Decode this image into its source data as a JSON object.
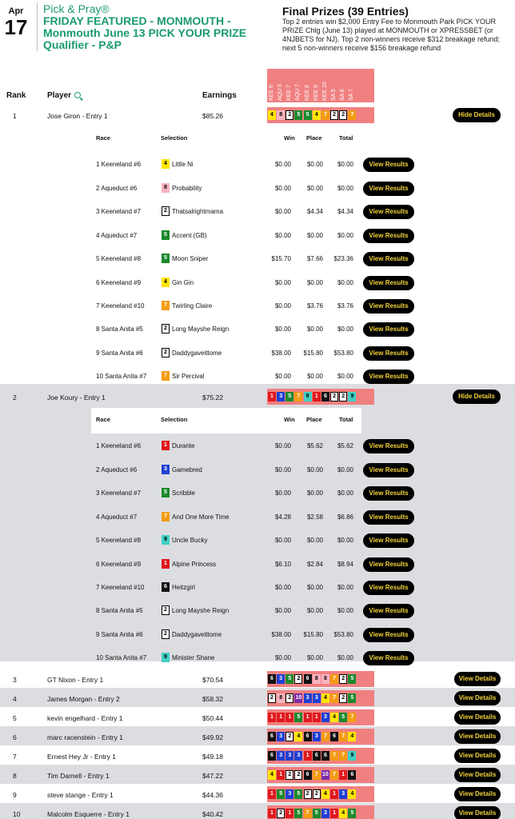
{
  "header": {
    "month": "Apr",
    "day": "17",
    "contest_type": "Pick & Pray®",
    "contest_title": "FRIDAY FEATURED - MONMOUTH - Monmouth June 13 PICK YOUR PRIZE Qualifier - P&P",
    "prizes_title": "Final Prizes (39 Entries)",
    "prizes_text": "Top 2 entries win $2,000 Entry Fee to Monmouth Park PICK YOUR PRIZE Chlg (June 13) played at MONMOUTH or XPRESSBET (or 4NJBETS for NJ). Top 2 non-winners receive $312 breakage refund; next 5 non-winners receive $156 breakage refund"
  },
  "columns": {
    "rank": "Rank",
    "player": "Player",
    "earnings": "Earnings"
  },
  "race_headers": [
    "KEE 6",
    "AQU 6",
    "KEE 7",
    "AQU 7",
    "KEE 8",
    "KEE 9",
    "KEE 10",
    "SA 5",
    "SA 6",
    "SA 7"
  ],
  "detail_headers": {
    "race": "Race",
    "selection": "Selection",
    "win": "Win",
    "place": "Place",
    "total": "Total"
  },
  "colors": {
    "1": "#e0191d",
    "2": "#ffffff",
    "3": "#1f3fd4",
    "4": "#ffe500",
    "5": "#1b8a2c",
    "6": "#111111",
    "7": "#f39c12",
    "8": "#f8b3c0",
    "9": "#3fd0c5",
    "10": "#7b2ca8"
  },
  "entries": [
    {
      "rank": "1",
      "player": "Jose Giron - Entry 1",
      "earnings": "$85.26",
      "picks": [
        "4",
        "8",
        "2",
        "5",
        "5",
        "4",
        "7",
        "2",
        "2",
        "7"
      ],
      "button": "Hide Details",
      "details": [
        {
          "race": "1 Keeneland #6",
          "num": "4",
          "horse": "Little Ni",
          "win": "$0.00",
          "place": "$0.00",
          "total": "$0.00"
        },
        {
          "race": "2 Aqueduct #6",
          "num": "8",
          "horse": "Probability",
          "win": "$0.00",
          "place": "$0.00",
          "total": "$0.00"
        },
        {
          "race": "3 Keeneland #7",
          "num": "2",
          "horse": "Thatsalrightmama",
          "win": "$0.00",
          "place": "$4.34",
          "total": "$4.34"
        },
        {
          "race": "4 Aqueduct #7",
          "num": "5",
          "horse": "Accent (GB)",
          "win": "$0.00",
          "place": "$0.00",
          "total": "$0.00"
        },
        {
          "race": "5 Keeneland #8",
          "num": "5",
          "horse": "Moon Sniper",
          "win": "$15.70",
          "place": "$7.66",
          "total": "$23.36"
        },
        {
          "race": "6 Keeneland #9",
          "num": "4",
          "horse": "Gin Gin",
          "win": "$0.00",
          "place": "$0.00",
          "total": "$0.00"
        },
        {
          "race": "7 Keeneland #10",
          "num": "7",
          "horse": "Twirling Claire",
          "win": "$0.00",
          "place": "$3.76",
          "total": "$3.76"
        },
        {
          "race": "8 Santa Anita #5",
          "num": "2",
          "horse": "Long Mayshe Reign",
          "win": "$0.00",
          "place": "$0.00",
          "total": "$0.00"
        },
        {
          "race": "9 Santa Anita #6",
          "num": "2",
          "horse": "Daddygaveittome",
          "win": "$38.00",
          "place": "$15.80",
          "total": "$53.80"
        },
        {
          "race": "10 Santa Anita #7",
          "num": "7",
          "horse": "Sir Percival",
          "win": "$0.00",
          "place": "$0.00",
          "total": "$0.00"
        }
      ]
    },
    {
      "rank": "2",
      "player": "Joe Koury - Entry 1",
      "earnings": "$75.22",
      "picks": [
        "1",
        "3",
        "5",
        "7",
        "9",
        "1",
        "6",
        "2",
        "2",
        "9"
      ],
      "button": "Hide Details",
      "details": [
        {
          "race": "1 Keeneland #6",
          "num": "1",
          "horse": "Durante",
          "win": "$0.00",
          "place": "$5.62",
          "total": "$5.62"
        },
        {
          "race": "2 Aqueduct #6",
          "num": "3",
          "horse": "Gamebred",
          "win": "$0.00",
          "place": "$0.00",
          "total": "$0.00"
        },
        {
          "race": "3 Keeneland #7",
          "num": "5",
          "horse": "Scribble",
          "win": "$0.00",
          "place": "$0.00",
          "total": "$0.00"
        },
        {
          "race": "4 Aqueduct #7",
          "num": "7",
          "horse": "And One More Time",
          "win": "$4.28",
          "place": "$2.58",
          "total": "$6.86"
        },
        {
          "race": "5 Keeneland #8",
          "num": "9",
          "horse": "Uncle Bucky",
          "win": "$0.00",
          "place": "$0.00",
          "total": "$0.00"
        },
        {
          "race": "6 Keeneland #9",
          "num": "1",
          "horse": "Alpine Princess",
          "win": "$6.10",
          "place": "$2.84",
          "total": "$8.94"
        },
        {
          "race": "7 Keeneland #10",
          "num": "6",
          "horse": "Heitzgirl",
          "win": "$0.00",
          "place": "$0.00",
          "total": "$0.00"
        },
        {
          "race": "8 Santa Anita #5",
          "num": "2",
          "horse": "Long Mayshe Reign",
          "win": "$0.00",
          "place": "$0.00",
          "total": "$0.00"
        },
        {
          "race": "9 Santa Anita #6",
          "num": "2",
          "horse": "Daddygaveittome",
          "win": "$38.00",
          "place": "$15.80",
          "total": "$53.80"
        },
        {
          "race": "10 Santa Anita #7",
          "num": "9",
          "horse": "Minister Shane",
          "win": "$0.00",
          "place": "$0.00",
          "total": "$0.00"
        }
      ]
    },
    {
      "rank": "3",
      "player": "GT Nixon - Entry 1",
      "earnings": "$70.54",
      "picks": [
        "6",
        "3",
        "5",
        "2",
        "6",
        "8",
        "8",
        "7",
        "2",
        "5"
      ],
      "button": "View Details"
    },
    {
      "rank": "4",
      "player": "James Morgan - Entry 2",
      "earnings": "$58.32",
      "picks": [
        "2",
        "8",
        "2",
        "10",
        "3",
        "3",
        "4",
        "7",
        "2",
        "5"
      ],
      "button": "View Details"
    },
    {
      "rank": "5",
      "player": "kevin engelhard - Entry 1",
      "earnings": "$50.44",
      "picks": [
        "1",
        "1",
        "1",
        "5",
        "1",
        "1",
        "3",
        "4",
        "5",
        "7"
      ],
      "button": "View Details"
    },
    {
      "rank": "6",
      "player": "marc racenstein - Entry 1",
      "earnings": "$49.92",
      "picks": [
        "6",
        "3",
        "2",
        "4",
        "6",
        "3",
        "7",
        "6",
        "7",
        "4"
      ],
      "button": "View Details"
    },
    {
      "rank": "7",
      "player": "Ernest Hey Jr - Entry 1",
      "earnings": "$49.18",
      "picks": [
        "6",
        "3",
        "3",
        "3",
        "1",
        "6",
        "6",
        "7",
        "7",
        "9"
      ],
      "button": "View Details"
    },
    {
      "rank": "8",
      "player": "Tim Darnell - Entry 1",
      "earnings": "$47.22",
      "picks": [
        "4",
        "1",
        "2",
        "2",
        "6",
        "7",
        "10",
        "7",
        "1",
        "6"
      ],
      "button": "View Details"
    },
    {
      "rank": "9",
      "player": "steve stange - Entry 1",
      "earnings": "$44.36",
      "picks": [
        "1",
        "5",
        "3",
        "5",
        "2",
        "2",
        "4",
        "1",
        "3",
        "4"
      ],
      "button": "View Details"
    },
    {
      "rank": "10",
      "player": "Malcolm Esquerre - Entry 1",
      "earnings": "$40.42",
      "picks": [
        "1",
        "2",
        "1",
        "5",
        "7",
        "5",
        "3",
        "1",
        "4",
        "5"
      ],
      "button": "View Details"
    }
  ],
  "view_results_label": "View Results"
}
